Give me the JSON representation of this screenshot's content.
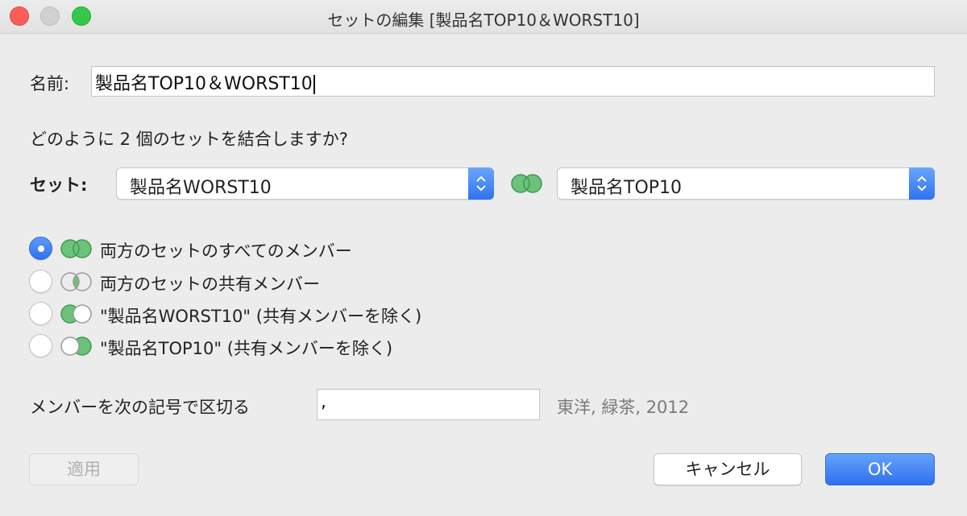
{
  "window": {
    "title": "セットの編集 [製品名TOP10＆WORST10]"
  },
  "name": {
    "label": "名前:",
    "value": "製品名TOP10＆WORST10"
  },
  "question": "どのように 2 個のセットを結合しますか?",
  "sets": {
    "label": "セット:",
    "left_value": "製品名WORST10",
    "right_value": "製品名TOP10"
  },
  "options": [
    {
      "label": "両方のセットのすべてのメンバー",
      "selected": true
    },
    {
      "label": "両方のセットの共有メンバー",
      "selected": false
    },
    {
      "label": "\"製品名WORST10\" (共有メンバーを除く)",
      "selected": false
    },
    {
      "label": "\"製品名TOP10\" (共有メンバーを除く)",
      "selected": false
    }
  ],
  "separator": {
    "label": "メンバーを次の記号で区切る",
    "value": ",",
    "example": "東洋, 緑茶, 2012"
  },
  "buttons": {
    "apply": "適用",
    "cancel": "キャンセル",
    "ok": "OK"
  },
  "colors": {
    "accent": "#2f70f0",
    "venn_fill": "#6cc27a",
    "venn_stroke": "#3f9a4f"
  }
}
